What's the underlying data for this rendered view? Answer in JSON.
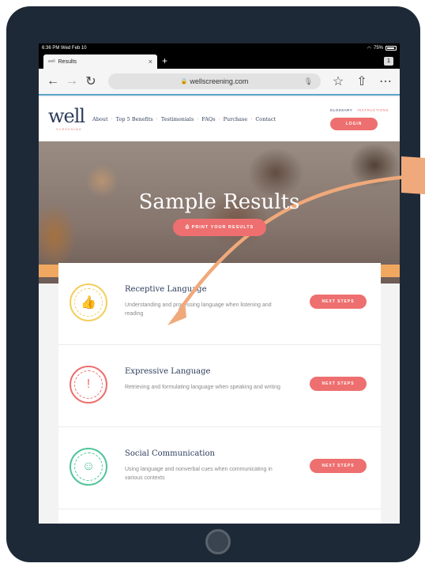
{
  "statusbar": {
    "time": "6:36 PM  Wed Feb 10",
    "battery": "75%"
  },
  "browser": {
    "tab_title": "Results",
    "tab_favicon": "well",
    "tab_close": "×",
    "new_tab": "+",
    "tab_count": "1",
    "url": "wellscreening.com",
    "icons": {
      "back": "back-arrow-icon",
      "forward": "forward-arrow-icon",
      "reload": "reload-icon",
      "mic": "mic-icon",
      "star": "star-icon",
      "share": "share-icon",
      "more": "more-icon"
    }
  },
  "site": {
    "logo": "well",
    "logo_sub": "SCREENING",
    "nav": [
      "About",
      "Top 5 Benefits",
      "Testimonials",
      "FAQs",
      "Purchase",
      "Contact"
    ],
    "top_links": {
      "glossary": "GLOSSARY",
      "instructions": "INSTRUCTIONS"
    },
    "login": "LOGIN"
  },
  "hero": {
    "title": "Sample Results",
    "print_button": "PRINT YOUR RESULTS"
  },
  "cards": [
    {
      "title": "Receptive Language",
      "description": "Understanding and processing language when listening and reading",
      "button": "NEXT STEPS",
      "badge_color": "#f2cf5b",
      "badge_icon": "thumbs-up-icon"
    },
    {
      "title": "Expressive Language",
      "description": "Retrieving and formulating language when speaking and writing",
      "button": "NEXT STEPS",
      "badge_color": "#ee6f6f",
      "badge_icon": "exclamation-icon"
    },
    {
      "title": "Social Communication",
      "description": "Using language and nonverbal cues when communicating in various contexts",
      "button": "NEXT STEPS",
      "badge_color": "#52c49a",
      "badge_icon": "smiley-icon"
    }
  ],
  "colors": {
    "accent": "#ee6f6f",
    "brand": "#2d3c5b",
    "arrow": "#f0a97a",
    "frame": "#1e2937"
  }
}
